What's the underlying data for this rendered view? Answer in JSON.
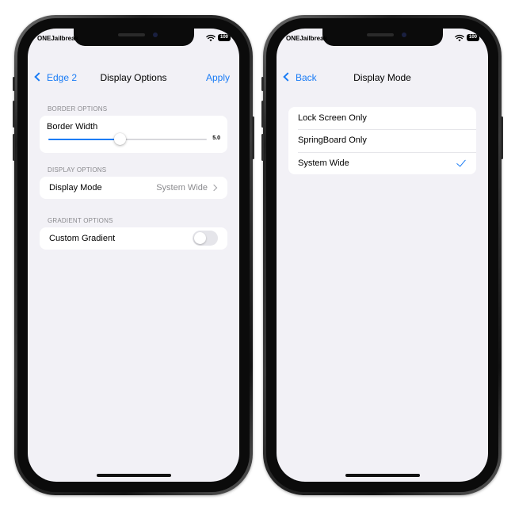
{
  "colors": {
    "accent": "#1a7cf5",
    "screen_bg": "#f2f1f6",
    "secondary_text": "#8a8a8e"
  },
  "left_phone": {
    "status": {
      "carrier": "ONEJailbreak",
      "battery": "100"
    },
    "nav": {
      "back_label": "Edge 2",
      "title": "Display Options",
      "action_label": "Apply"
    },
    "sections": {
      "border": {
        "header": "BORDER OPTIONS",
        "row_label": "Border Width",
        "slider_value_text": "5.0",
        "slider_fraction": 0.45
      },
      "display": {
        "header": "DISPLAY OPTIONS",
        "row_label": "Display Mode",
        "row_value": "System Wide"
      },
      "gradient": {
        "header": "GRADIENT OPTIONS",
        "row_label": "Custom Gradient",
        "toggle_on": false
      }
    }
  },
  "right_phone": {
    "status": {
      "carrier": "ONEJailbreak",
      "battery": "100"
    },
    "nav": {
      "back_label": "Back",
      "title": "Display Mode"
    },
    "options": [
      {
        "label": "Lock Screen Only",
        "selected": false
      },
      {
        "label": "SpringBoard Only",
        "selected": false
      },
      {
        "label": "System Wide",
        "selected": true
      }
    ]
  }
}
